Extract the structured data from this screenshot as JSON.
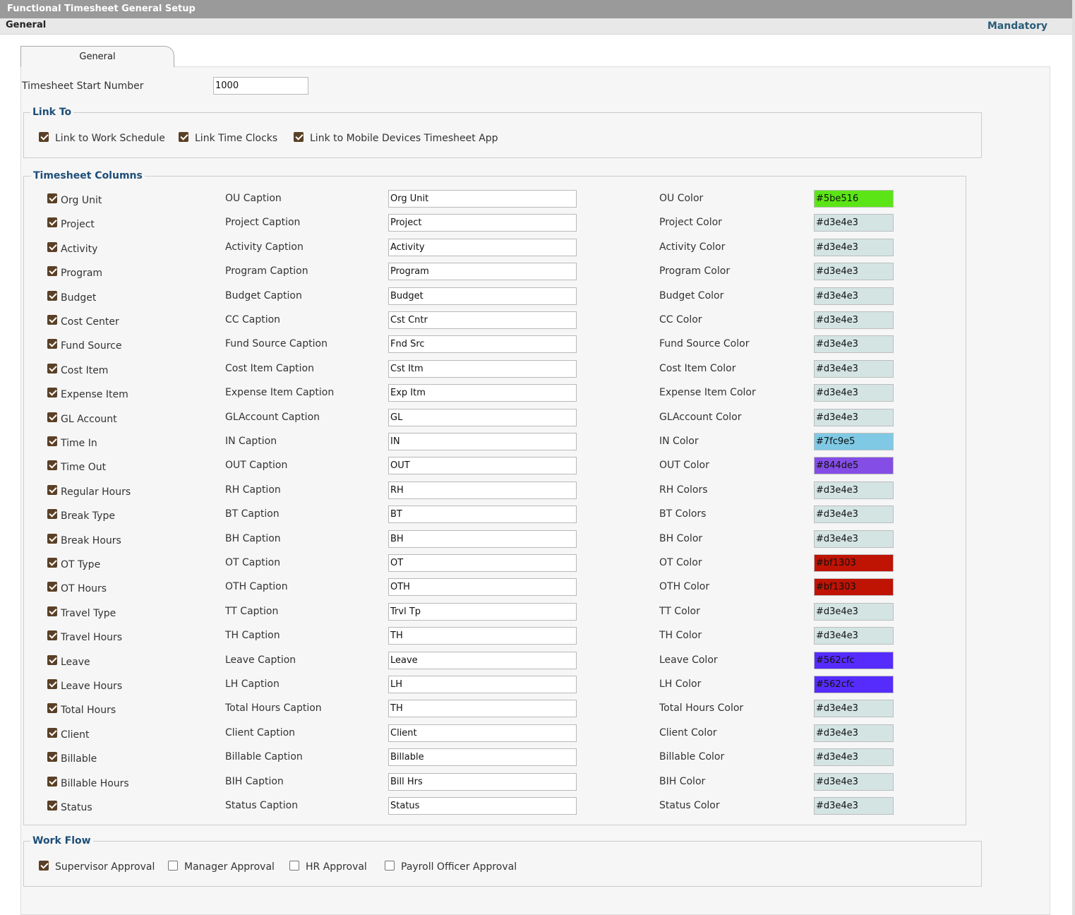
{
  "header": {
    "title": "Functional Timesheet General Setup",
    "section": "General",
    "mandatory": "Mandatory"
  },
  "tab": {
    "label": "General"
  },
  "start_number": {
    "label": "Timesheet Start Number",
    "value": "1000"
  },
  "link_to": {
    "legend": "Link To",
    "items": [
      {
        "label": "Link to Work Schedule",
        "checked": true
      },
      {
        "label": "Link Time Clocks",
        "checked": true
      },
      {
        "label": "Link to Mobile Devices Timesheet App",
        "checked": true
      }
    ]
  },
  "columns": {
    "legend": "Timesheet Columns",
    "rows": [
      {
        "name": "Org Unit",
        "checked": true,
        "caption_label": "OU Caption",
        "caption_value": "Org Unit",
        "color_label": "OU Color",
        "color": "#5be516"
      },
      {
        "name": "Project",
        "checked": true,
        "caption_label": "Project Caption",
        "caption_value": "Project",
        "color_label": "Project Color",
        "color": "#d3e4e3"
      },
      {
        "name": "Activity",
        "checked": true,
        "caption_label": "Activity Caption",
        "caption_value": "Activity",
        "color_label": "Activity Color",
        "color": "#d3e4e3"
      },
      {
        "name": "Program",
        "checked": true,
        "caption_label": "Program Caption",
        "caption_value": "Program",
        "color_label": "Program Color",
        "color": "#d3e4e3"
      },
      {
        "name": "Budget",
        "checked": true,
        "caption_label": "Budget Caption",
        "caption_value": "Budget",
        "color_label": "Budget Color",
        "color": "#d3e4e3"
      },
      {
        "name": "Cost Center",
        "checked": true,
        "caption_label": "CC Caption",
        "caption_value": "Cst Cntr",
        "color_label": "CC Color",
        "color": "#d3e4e3"
      },
      {
        "name": "Fund Source",
        "checked": true,
        "caption_label": "Fund Source Caption",
        "caption_value": "Fnd Src",
        "color_label": "Fund Source Color",
        "color": "#d3e4e3"
      },
      {
        "name": "Cost Item",
        "checked": true,
        "caption_label": "Cost Item Caption",
        "caption_value": "Cst Itm",
        "color_label": "Cost Item Color",
        "color": "#d3e4e3"
      },
      {
        "name": "Expense Item",
        "checked": true,
        "caption_label": "Expense Item Caption",
        "caption_value": "Exp Itm",
        "color_label": "Expense Item Color",
        "color": "#d3e4e3"
      },
      {
        "name": "GL Account",
        "checked": true,
        "caption_label": "GLAccount Caption",
        "caption_value": "GL",
        "color_label": "GLAccount Color",
        "color": "#d3e4e3"
      },
      {
        "name": "Time In",
        "checked": true,
        "caption_label": "IN Caption",
        "caption_value": "IN",
        "color_label": "IN Color",
        "color": "#7fc9e5"
      },
      {
        "name": "Time Out",
        "checked": true,
        "caption_label": "OUT Caption",
        "caption_value": "OUT",
        "color_label": "OUT Color",
        "color": "#844de5"
      },
      {
        "name": "Regular Hours",
        "checked": true,
        "caption_label": "RH Caption",
        "caption_value": "RH",
        "color_label": "RH Colors",
        "color": "#d3e4e3"
      },
      {
        "name": "Break Type",
        "checked": true,
        "caption_label": "BT Caption",
        "caption_value": "BT",
        "color_label": "BT Colors",
        "color": "#d3e4e3"
      },
      {
        "name": "Break Hours",
        "checked": true,
        "caption_label": "BH Caption",
        "caption_value": "BH",
        "color_label": "BH Color",
        "color": "#d3e4e3"
      },
      {
        "name": "OT Type",
        "checked": true,
        "caption_label": "OT Caption",
        "caption_value": "OT",
        "color_label": "OT Color",
        "color": "#bf1303"
      },
      {
        "name": "OT Hours",
        "checked": true,
        "caption_label": "OTH Caption",
        "caption_value": "OTH",
        "color_label": "OTH Color",
        "color": "#bf1303"
      },
      {
        "name": "Travel Type",
        "checked": true,
        "caption_label": "TT Caption",
        "caption_value": "Trvl Tp",
        "color_label": "TT Color",
        "color": "#d3e4e3"
      },
      {
        "name": "Travel Hours",
        "checked": true,
        "caption_label": "TH Caption",
        "caption_value": "TH",
        "color_label": "TH Color",
        "color": "#d3e4e3"
      },
      {
        "name": "Leave",
        "checked": true,
        "caption_label": "Leave Caption",
        "caption_value": "Leave",
        "color_label": "Leave Color",
        "color": "#562cfc"
      },
      {
        "name": "Leave Hours",
        "checked": true,
        "caption_label": "LH Caption",
        "caption_value": "LH",
        "color_label": "LH Color",
        "color": "#562cfc"
      },
      {
        "name": "Total Hours",
        "checked": true,
        "caption_label": "Total Hours Caption",
        "caption_value": "TH",
        "color_label": "Total Hours Color",
        "color": "#d3e4e3"
      },
      {
        "name": "Client",
        "checked": true,
        "caption_label": "Client Caption",
        "caption_value": "Client",
        "color_label": "Client Color",
        "color": "#d3e4e3"
      },
      {
        "name": "Billable",
        "checked": true,
        "caption_label": "Billable Caption",
        "caption_value": "Billable",
        "color_label": "Billable Color",
        "color": "#d3e4e3"
      },
      {
        "name": "Billable Hours",
        "checked": true,
        "caption_label": "BIH Caption",
        "caption_value": "Bill Hrs",
        "color_label": "BIH Color",
        "color": "#d3e4e3"
      },
      {
        "name": "Status",
        "checked": true,
        "caption_label": "Status Caption",
        "caption_value": "Status",
        "color_label": "Status Color",
        "color": "#d3e4e3"
      }
    ]
  },
  "workflow": {
    "legend": "Work Flow",
    "items": [
      {
        "label": "Supervisor Approval",
        "checked": true
      },
      {
        "label": "Manager Approval",
        "checked": false
      },
      {
        "label": "HR Approval",
        "checked": false
      },
      {
        "label": "Payroll Officer Approval",
        "checked": false
      }
    ]
  }
}
